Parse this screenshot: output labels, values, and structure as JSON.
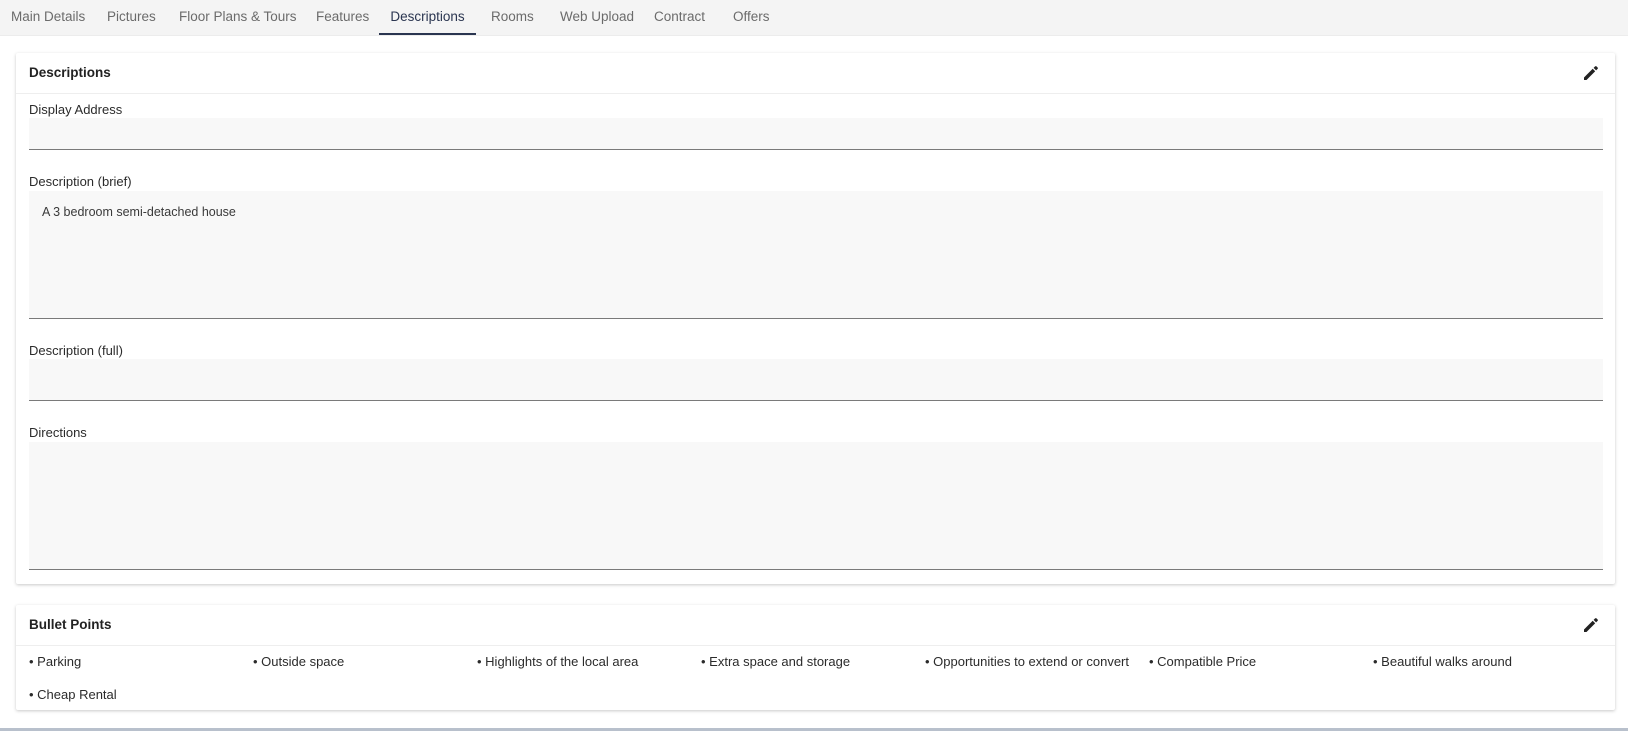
{
  "tabs": [
    {
      "label": "Main Details"
    },
    {
      "label": "Pictures"
    },
    {
      "label": "Floor Plans & Tours"
    },
    {
      "label": "Features"
    },
    {
      "label": "Descriptions"
    },
    {
      "label": "Rooms"
    },
    {
      "label": "Web Upload"
    },
    {
      "label": "Contract"
    },
    {
      "label": "Offers"
    }
  ],
  "active_tab": "Descriptions",
  "descriptions": {
    "title": "Descriptions",
    "edit_icon": "pencil-icon",
    "fields": {
      "display_address": {
        "label": "Display Address",
        "value": ""
      },
      "description_brief": {
        "label": "Description (brief)",
        "value": "A 3 bedroom semi-detached house"
      },
      "description_full": {
        "label": "Description (full)",
        "value": ""
      },
      "directions": {
        "label": "Directions",
        "value": ""
      }
    }
  },
  "bullet_points": {
    "title": "Bullet Points",
    "edit_icon": "pencil-icon",
    "items": [
      "• Parking",
      "• Outside space",
      "• Highlights of the local area",
      "• Extra space and storage",
      "• Opportunities to extend or convert",
      "• Compatible Price",
      "• Beautiful walks around",
      "• Cheap Rental"
    ]
  },
  "colors": {
    "active_tab": "#2a3550",
    "inactive_tab": "#6b6b6b",
    "field_background": "#f8f8f8"
  }
}
